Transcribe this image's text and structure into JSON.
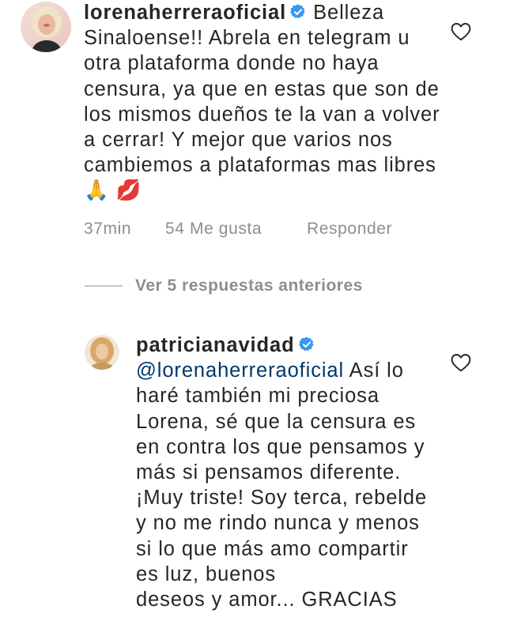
{
  "comments": [
    {
      "username": "lorenaherreraoficial",
      "verified": true,
      "text": "Belleza Sinaloense!! Abrela en telegram u otra plataforma donde no haya censura, ya que en estas que son de los mismos dueños te la van a volver a cerrar! Y mejor que varios nos cambiemos a plataformas mas libres 🙏 💋",
      "time": "37min",
      "likes": "54 Me gusta",
      "reply_label": "Responder",
      "like_icon": "heart-outline-icon"
    },
    {
      "username": "patricianavidad",
      "verified": true,
      "mention": "@lorenaherreraoficial",
      "text": "Así lo haré también mi preciosa Lorena, sé que la censura es en contra los que pensamos y más si pensamos diferente. ¡Muy triste! Soy terca, rebelde y no me rindo nunca y menos si lo que más amo compartir es luz, buenos",
      "cut_off_line": "deseos y amor... GRACIAS",
      "like_icon": "heart-outline-icon"
    }
  ],
  "replies_toggle": {
    "label": "Ver 5 respuestas anteriores"
  },
  "colors": {
    "text": "#262626",
    "secondary": "#8e8e8e",
    "mention": "#00376b",
    "verified": "#3897f0"
  }
}
